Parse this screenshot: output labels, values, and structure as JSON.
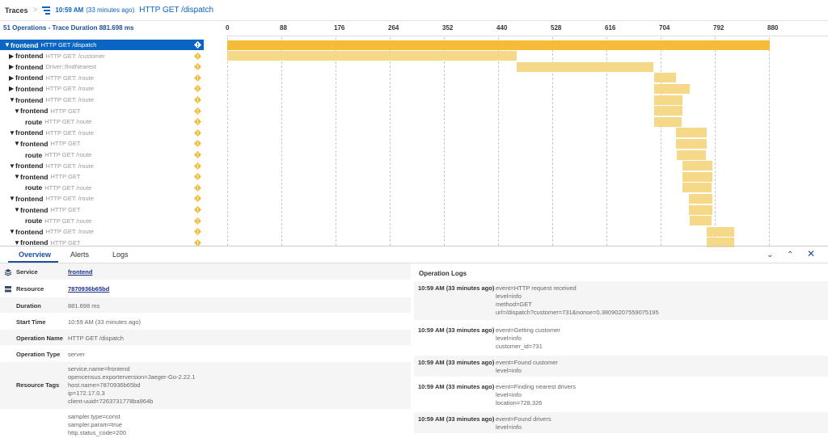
{
  "breadcrumb": {
    "root": "Traces",
    "separator": ">",
    "time": "10:59 AM",
    "ago": "(33 minutes ago)",
    "title": "HTTP GET /dispatch"
  },
  "summary": "51 Operations - Trace Duration 881.698 ms",
  "timeline": {
    "ticks": [
      "0",
      "88",
      "176",
      "264",
      "352",
      "440",
      "528",
      "616",
      "704",
      "792",
      "880"
    ],
    "max_ms": 881.698
  },
  "spans": [
    {
      "arrow": "▼",
      "service": "frontend",
      "operation": "HTTP GET /dispatch",
      "depth": 0,
      "start": 0,
      "duration": 881.698,
      "selected": true
    },
    {
      "arrow": "▶",
      "service": "frontend",
      "operation": "HTTP GET: /customer",
      "depth": 1,
      "start": 0,
      "duration": 470
    },
    {
      "arrow": "▶",
      "service": "frontend",
      "operation": "Driver::findNearest",
      "depth": 1,
      "start": 470,
      "duration": 222
    },
    {
      "arrow": "▶",
      "service": "frontend",
      "operation": "HTTP GET: /route",
      "depth": 1,
      "start": 693,
      "duration": 36
    },
    {
      "arrow": "▶",
      "service": "frontend",
      "operation": "HTTP GET: /route",
      "depth": 1,
      "start": 693,
      "duration": 58
    },
    {
      "arrow": "▼",
      "service": "frontend",
      "operation": "HTTP GET: /route",
      "depth": 1,
      "start": 693,
      "duration": 46
    },
    {
      "arrow": "▼",
      "service": "frontend",
      "operation": "HTTP GET",
      "depth": 2,
      "start": 693,
      "duration": 46
    },
    {
      "arrow": "",
      "service": "route",
      "operation": "HTTP GET /route",
      "depth": 3,
      "start": 694,
      "duration": 44
    },
    {
      "arrow": "▼",
      "service": "frontend",
      "operation": "HTTP GET: /route",
      "depth": 1,
      "start": 729,
      "duration": 50
    },
    {
      "arrow": "▼",
      "service": "frontend",
      "operation": "HTTP GET",
      "depth": 2,
      "start": 729,
      "duration": 50
    },
    {
      "arrow": "",
      "service": "route",
      "operation": "HTTP GET /route",
      "depth": 3,
      "start": 730,
      "duration": 48
    },
    {
      "arrow": "▼",
      "service": "frontend",
      "operation": "HTTP GET: /route",
      "depth": 1,
      "start": 739,
      "duration": 49
    },
    {
      "arrow": "▼",
      "service": "frontend",
      "operation": "HTTP GET",
      "depth": 2,
      "start": 739,
      "duration": 49
    },
    {
      "arrow": "",
      "service": "route",
      "operation": "HTTP GET /route",
      "depth": 3,
      "start": 740,
      "duration": 47
    },
    {
      "arrow": "▼",
      "service": "frontend",
      "operation": "HTTP GET: /route",
      "depth": 1,
      "start": 750,
      "duration": 38
    },
    {
      "arrow": "▼",
      "service": "frontend",
      "operation": "HTTP GET",
      "depth": 2,
      "start": 750,
      "duration": 38
    },
    {
      "arrow": "",
      "service": "route",
      "operation": "HTTP GET /route",
      "depth": 3,
      "start": 751,
      "duration": 36
    },
    {
      "arrow": "▼",
      "service": "frontend",
      "operation": "HTTP GET: /route",
      "depth": 1,
      "start": 779,
      "duration": 44
    },
    {
      "arrow": "▼",
      "service": "frontend",
      "operation": "HTTP GET",
      "depth": 2,
      "start": 779,
      "duration": 44
    }
  ],
  "tabs": [
    "Overview",
    "Alerts",
    "Logs"
  ],
  "controls": {
    "down": "⌄",
    "up": "⌃",
    "close": "✕"
  },
  "details": [
    {
      "label": "Service",
      "value": "frontend",
      "link": true,
      "icon": "layers-icon"
    },
    {
      "label": "Resource",
      "value": "7870936b65bd",
      "link": true,
      "icon": "server-icon"
    },
    {
      "label": "Duration",
      "value": "881.698 ms"
    },
    {
      "label": "Start Time",
      "value": "10:59 AM  (33 minutes ago)"
    },
    {
      "label": "Operation Name",
      "value": "HTTP GET /dispatch"
    },
    {
      "label": "Operation Type",
      "value": "server"
    },
    {
      "label": "Resource Tags",
      "lines": [
        "service.name=frontend",
        "opencensus.exporterversion=Jaeger-Go-2.22.1",
        "host.name=7870936b65bd",
        "ip=172.17.0.3",
        "client-uuid=7263731778ba964b"
      ]
    },
    {
      "label": "",
      "lines": [
        "sampler.type=const",
        "sampler.param=true",
        "http.status_code=200"
      ]
    }
  ],
  "logs": {
    "title": "Operation Logs",
    "entries": [
      {
        "time": "10:59 AM",
        "ago": "(33 minutes ago)",
        "lines": [
          "event=HTTP request received",
          "level=info",
          "method=GET",
          "url=/dispatch?customer=731&nonse=0.38090207559075195"
        ]
      },
      {
        "time": "10:59 AM",
        "ago": "(33 minutes ago)",
        "lines": [
          "event=Getting customer",
          "level=info",
          "customer_id=731"
        ]
      },
      {
        "time": "10:59 AM",
        "ago": "(33 minutes ago)",
        "lines": [
          "event=Found customer",
          "level=info"
        ]
      },
      {
        "time": "10:59 AM",
        "ago": "(33 minutes ago)",
        "lines": [
          "event=Finding nearest drivers",
          "level=info",
          "location=728,326"
        ]
      },
      {
        "time": "10:59 AM",
        "ago": "(33 minutes ago)",
        "lines": [
          "event=Found drivers",
          "level=info"
        ]
      }
    ]
  },
  "colors": {
    "accent": "#0b65c2",
    "bar": "#f6d889",
    "bar_selected": "#f4bc39",
    "badge": "#f4bc39"
  }
}
